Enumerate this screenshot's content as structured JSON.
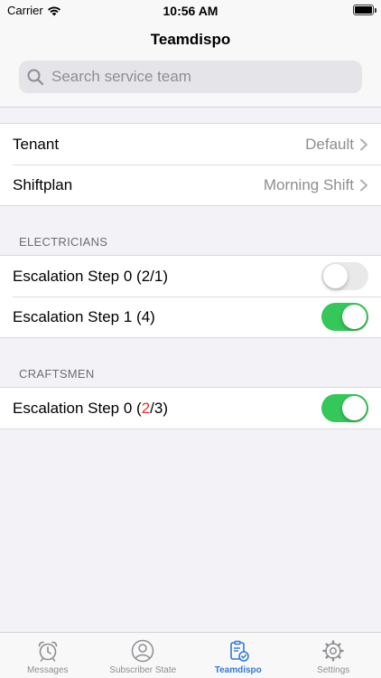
{
  "status_bar": {
    "carrier": "Carrier",
    "time": "10:56 AM",
    "wifi_icon": "wifi-icon",
    "battery_icon": "battery-icon"
  },
  "nav": {
    "title": "Teamdispo"
  },
  "search": {
    "placeholder": "Search service team",
    "icon": "search-icon"
  },
  "settings_rows": [
    {
      "label": "Tenant",
      "value": "Default"
    },
    {
      "label": "Shiftplan",
      "value": "Morning Shift"
    }
  ],
  "sections": [
    {
      "header": "ELECTRICIANS",
      "rows": [
        {
          "label_prefix": "Escalation Step 0 (",
          "label_highlight": "",
          "label_suffix": "2/1)",
          "toggle_on": false
        },
        {
          "label_prefix": "Escalation Step 1 (",
          "label_highlight": "",
          "label_suffix": "4)",
          "toggle_on": true
        }
      ]
    },
    {
      "header": "CRAFTSMEN",
      "rows": [
        {
          "label_prefix": "Escalation Step 0 (",
          "label_highlight": "2",
          "label_suffix": "/3)",
          "toggle_on": true
        }
      ]
    }
  ],
  "tabbar": {
    "items": [
      {
        "label": "Messages",
        "icon": "alarm-clock-icon",
        "active": false
      },
      {
        "label": "Subscriber State",
        "icon": "person-circle-icon",
        "active": false
      },
      {
        "label": "Teamdispo",
        "icon": "clipboard-check-icon",
        "active": true
      },
      {
        "label": "Settings",
        "icon": "gear-icon",
        "active": false
      }
    ]
  },
  "colors": {
    "accent": "#2f7ad6",
    "toggle_on": "#34c759",
    "highlight_red": "#e0322e"
  }
}
